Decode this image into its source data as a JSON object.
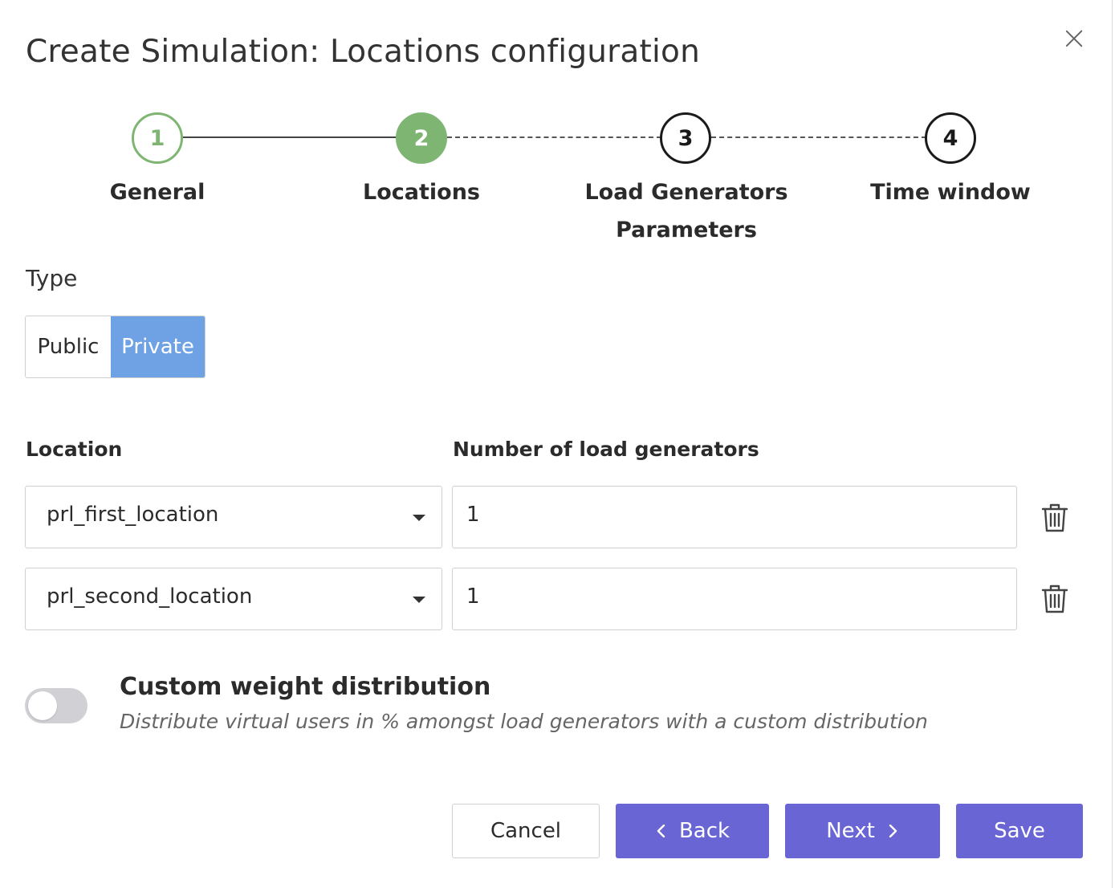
{
  "dialog": {
    "title": "Create Simulation: Locations configuration"
  },
  "stepper": {
    "steps": [
      {
        "number": "1",
        "label": "General",
        "state": "done"
      },
      {
        "number": "2",
        "label": "Locations",
        "state": "active"
      },
      {
        "number": "3",
        "label": "Load Generators Parameters",
        "state": "todo"
      },
      {
        "number": "4",
        "label": "Time window",
        "state": "todo"
      }
    ]
  },
  "type": {
    "label": "Type",
    "options": [
      "Public",
      "Private"
    ],
    "selected": "Private"
  },
  "locations": {
    "headers": {
      "location": "Location",
      "count": "Number of load generators"
    },
    "rows": [
      {
        "location": "prl_first_location",
        "count": "1"
      },
      {
        "location": "prl_second_location",
        "count": "1"
      }
    ]
  },
  "custom_weight": {
    "title": "Custom weight distribution",
    "description": "Distribute virtual users in % amongst load generators with a custom distribution",
    "enabled": false
  },
  "footer": {
    "cancel": "Cancel",
    "back": "Back",
    "next": "Next",
    "save": "Save"
  },
  "colors": {
    "step_done": "#7fb572",
    "segment_selected": "#6fa2e4",
    "primary_button": "#6a65d4"
  },
  "icons": {
    "close": "close-icon",
    "dropdown": "caret-down-icon",
    "delete": "trash-icon",
    "back": "chevron-left-icon",
    "next": "chevron-right-icon"
  }
}
